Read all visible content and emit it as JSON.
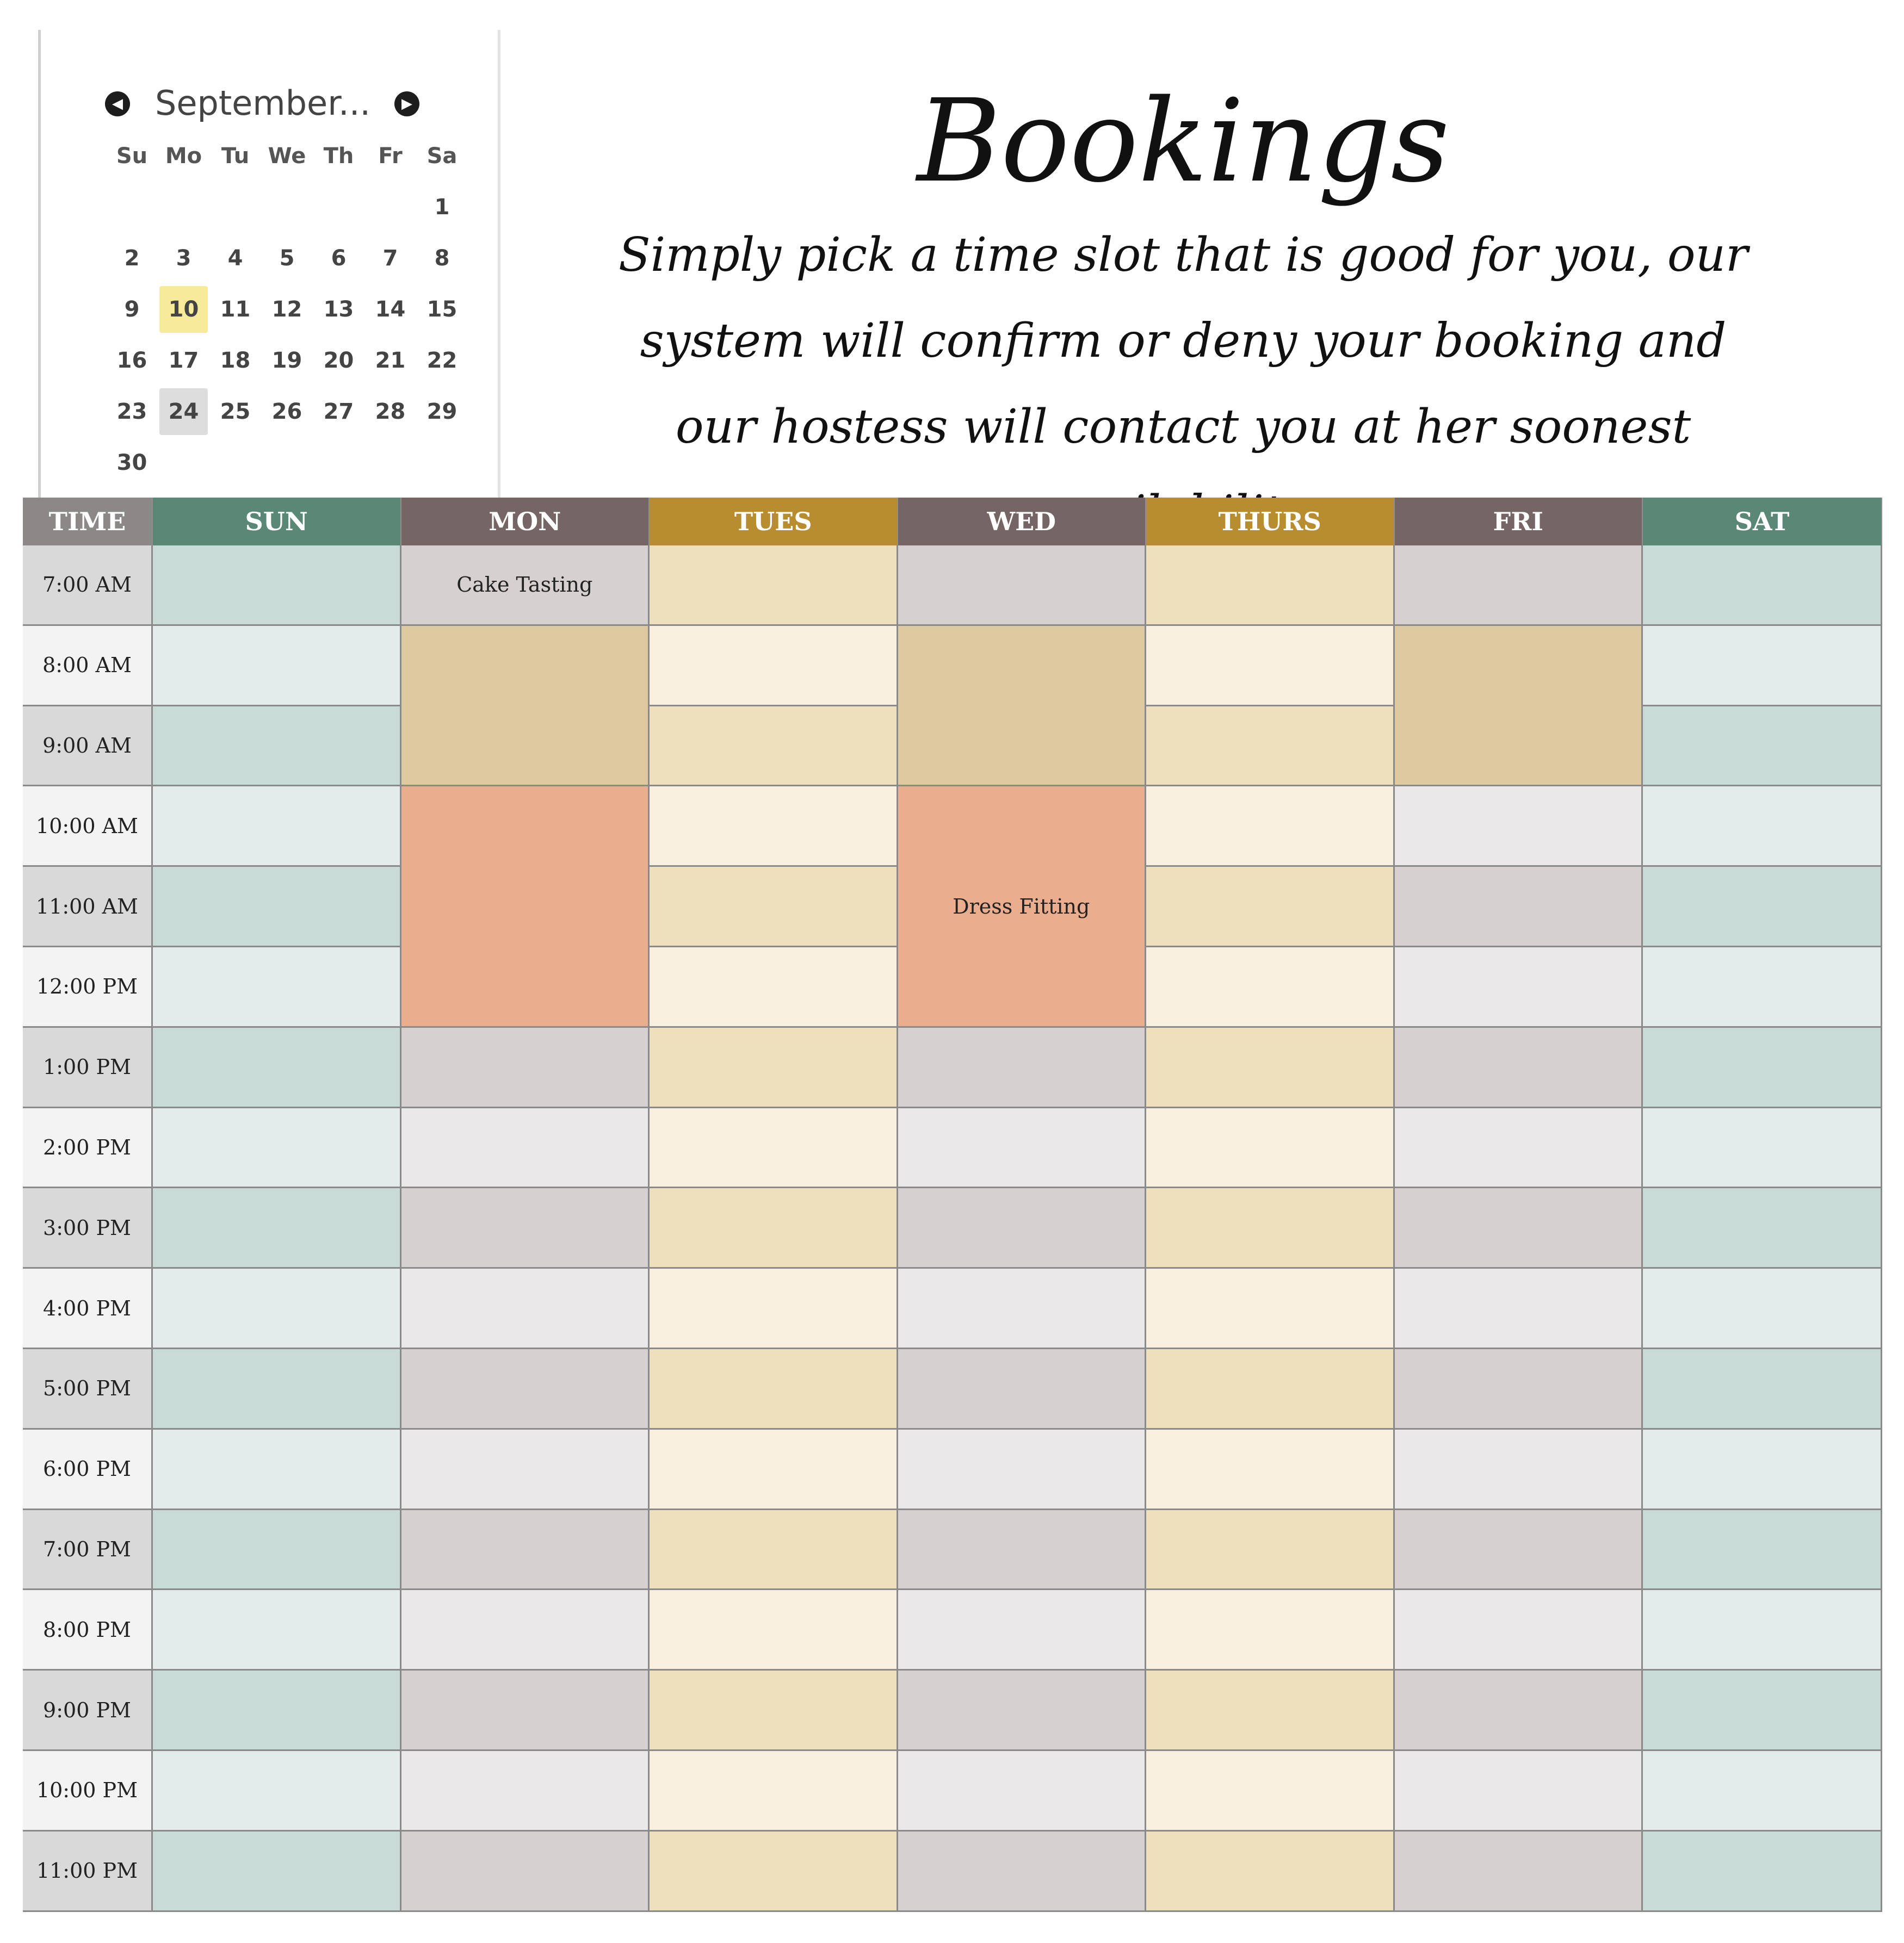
{
  "calendar": {
    "month_label": "September...",
    "prev_icon": "chevron-left-circle-icon",
    "next_icon": "chevron-right-circle-icon",
    "weekdays": [
      "Su",
      "Mo",
      "Tu",
      "We",
      "Th",
      "Fr",
      "Sa"
    ],
    "leading_blanks": 6,
    "days": [
      "1",
      "2",
      "3",
      "4",
      "5",
      "6",
      "7",
      "8",
      "9",
      "10",
      "11",
      "12",
      "13",
      "14",
      "15",
      "16",
      "17",
      "18",
      "19",
      "20",
      "21",
      "22",
      "23",
      "24",
      "25",
      "26",
      "27",
      "28",
      "29",
      "30"
    ],
    "highlighted_day": "10",
    "selected_day": "24",
    "highlight_color": "#f7ea9a",
    "selected_color": "#dddddd"
  },
  "header": {
    "title": "Bookings",
    "subtitle": "Simply pick a time slot that is good for you, our system will confirm or deny your booking and our hostess will contact you at her soonest availability."
  },
  "schedule": {
    "time_header": "TIME",
    "days": [
      "SUN",
      "MON",
      "TUES",
      "WED",
      "THURS",
      "FRI",
      "SAT"
    ],
    "header_colors": {
      "TIME": "#8b8887",
      "SUN": "#5b8777",
      "MON": "#756665",
      "TUES": "#b88d2f",
      "WED": "#756665",
      "THURS": "#b88d2f",
      "FRI": "#756665",
      "SAT": "#5b8777"
    },
    "times": [
      "7:00 AM",
      "8:00 AM",
      "9:00 AM",
      "10:00 AM",
      "11:00 AM",
      "12:00 PM",
      "1:00 PM",
      "2:00 PM",
      "3:00 PM",
      "4:00 PM",
      "5:00 PM",
      "6:00 PM",
      "7:00 PM",
      "8:00 PM",
      "9:00 PM",
      "10:00 PM",
      "11:00 PM"
    ],
    "row_colors": {
      "time": [
        "#d9d9d9",
        "#f3f3f3"
      ],
      "SUN": [
        "#c8dbd6",
        "#e3ecea"
      ],
      "MON": [
        "#d6d0d0",
        "#eae8e9"
      ],
      "TUES": [
        "#efe0bd",
        "#f8efdf"
      ],
      "WED": [
        "#d6d0d0",
        "#eae8e9"
      ],
      "THURS": [
        "#efe0bd",
        "#f8efdf"
      ],
      "FRI": [
        "#d6d0d0",
        "#eae8e9"
      ],
      "SAT": [
        "#c8dbd6",
        "#e3ecea"
      ]
    },
    "bookings": [
      {
        "day": "MON",
        "start": "7:00 AM",
        "hours": 1,
        "label": "Cake Tasting",
        "color": ""
      },
      {
        "day": "MON",
        "start": "8:00 AM",
        "hours": 2,
        "label": "",
        "color": "#dfc9a0"
      },
      {
        "day": "WED",
        "start": "8:00 AM",
        "hours": 2,
        "label": "",
        "color": "#dfc9a0"
      },
      {
        "day": "FRI",
        "start": "8:00 AM",
        "hours": 2,
        "label": "",
        "color": "#dfc9a0"
      },
      {
        "day": "MON",
        "start": "10:00 AM",
        "hours": 3,
        "label": "",
        "color": "#eaae8e"
      },
      {
        "day": "WED",
        "start": "10:00 AM",
        "hours": 3,
        "label": "Dress Fitting",
        "color": "#eaae8e"
      }
    ]
  }
}
